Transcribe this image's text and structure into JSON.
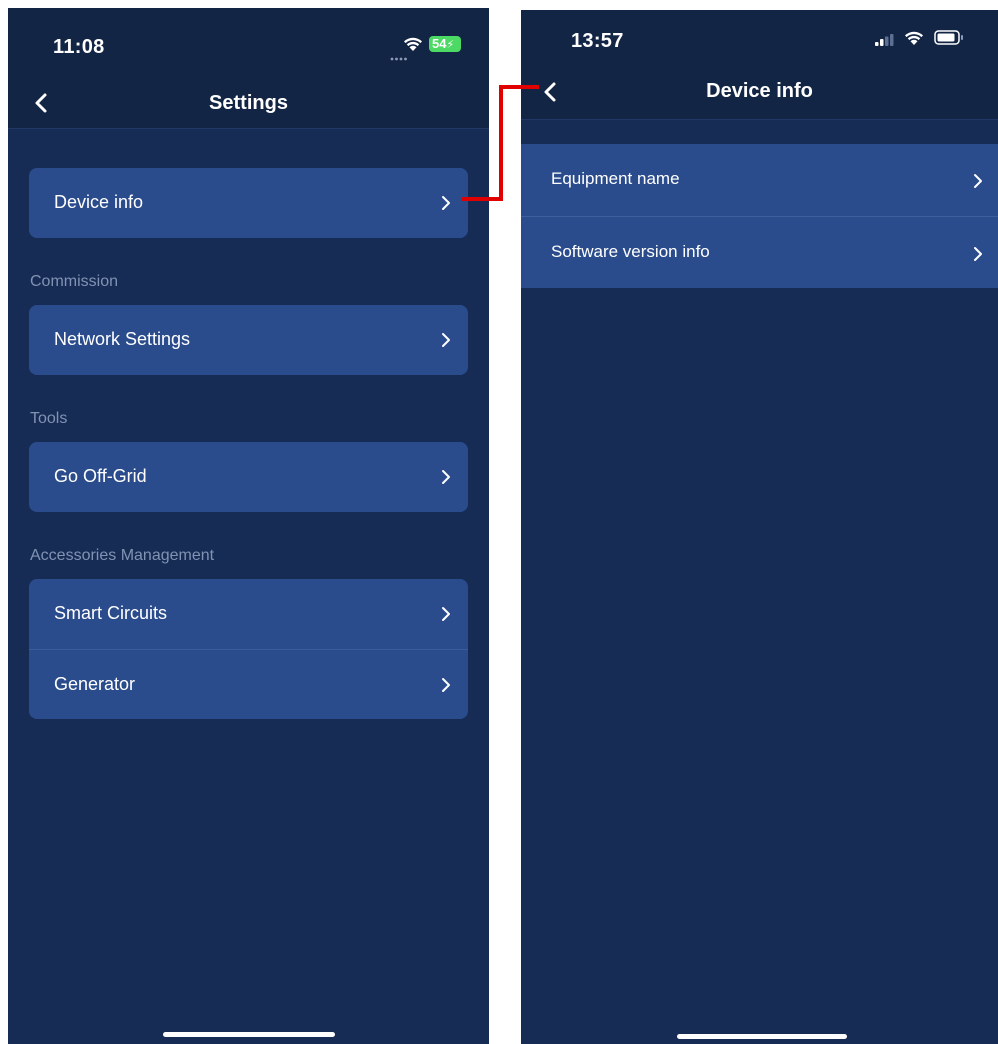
{
  "left_screen": {
    "status": {
      "time": "11:08",
      "battery": "54"
    },
    "nav": {
      "title": "Settings"
    },
    "group_device": [
      {
        "label": "Device info"
      }
    ],
    "commission": {
      "label": "Commission",
      "items": [
        {
          "label": "Network Settings"
        }
      ]
    },
    "tools": {
      "label": "Tools",
      "items": [
        {
          "label": "Go Off-Grid"
        }
      ]
    },
    "accessories": {
      "label": "Accessories Management",
      "items": [
        {
          "label": "Smart Circuits"
        },
        {
          "label": "Generator"
        }
      ]
    }
  },
  "right_screen": {
    "status": {
      "time": "13:57"
    },
    "nav": {
      "title": "Device info"
    },
    "items": [
      {
        "label": "Equipment name"
      },
      {
        "label": "Software version info"
      }
    ]
  },
  "colors": {
    "screen_bg": "#162c55",
    "bar_bg": "#132545",
    "card_bg": "#2b4c8c",
    "section_text": "#8093b3",
    "battery_green": "#4cd964",
    "annotation_red": "#e00000"
  },
  "icons": [
    "back-chevron-icon",
    "chevron-right-icon",
    "signal-dots-icon",
    "wifi-icon",
    "battery-charging-icon",
    "cellular-signal-icon",
    "battery-icon",
    "home-indicator"
  ]
}
